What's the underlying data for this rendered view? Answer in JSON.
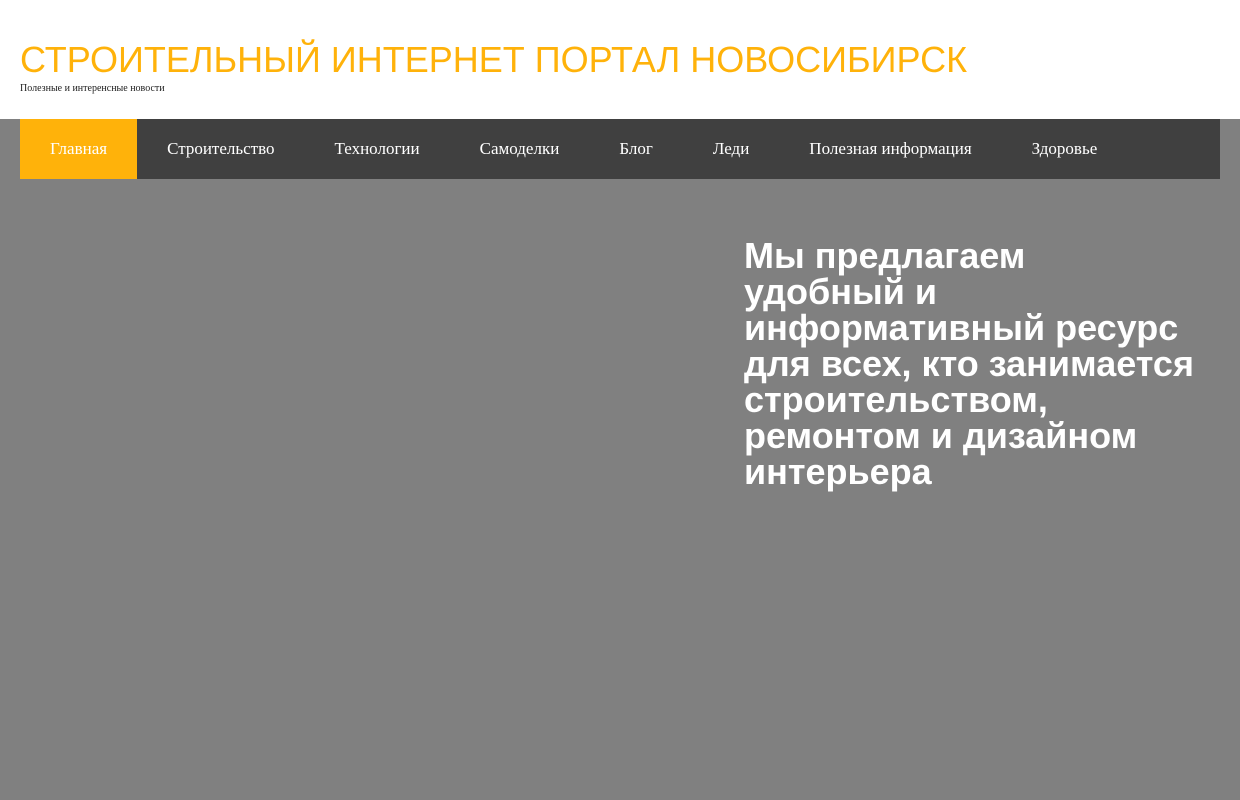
{
  "header": {
    "site_title": "СТРОИТЕЛЬНЫЙ ИНТЕРНЕТ ПОРТАЛ НОВОСИБИРСК",
    "tagline": "Полезные и интеренсные новости"
  },
  "nav": {
    "items": [
      {
        "label": "Главная",
        "active": true
      },
      {
        "label": "Строительство"
      },
      {
        "label": "Технологии"
      },
      {
        "label": "Самоделки"
      },
      {
        "label": "Блог"
      },
      {
        "label": "Леди"
      },
      {
        "label": "Полезная информация"
      },
      {
        "label": "Здоровье"
      }
    ]
  },
  "hero": {
    "text": "Мы предлагаем удобный и информативный ресурс для всех, кто занимается строительством, ремонтом и дизайном интерьера"
  },
  "colors": {
    "accent": "#ffb20a",
    "nav_background": "#404040",
    "hero_background": "#808080"
  }
}
